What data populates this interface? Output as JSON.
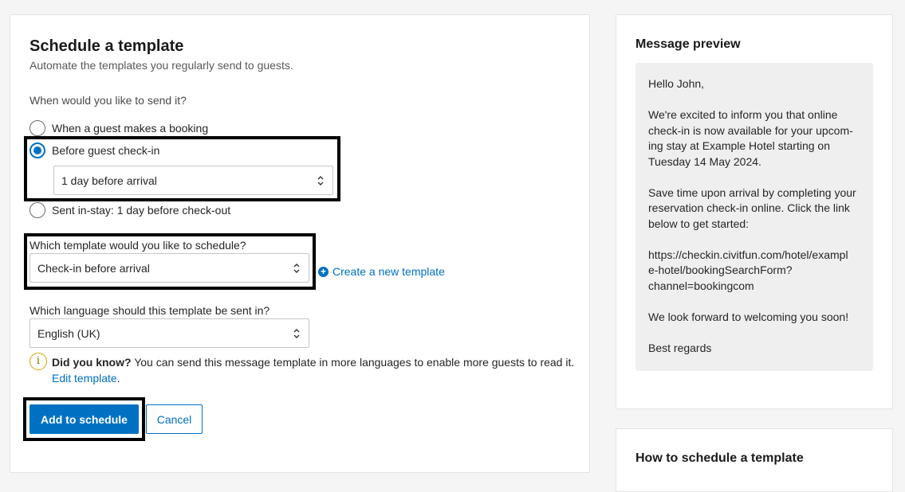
{
  "form": {
    "title": "Schedule a template",
    "subtitle": "Automate the templates you regularly send to guests.",
    "when_question": "When would you like to send it?",
    "options": [
      {
        "label": "When a guest makes a booking",
        "checked": false
      },
      {
        "label": "Before guest check-in",
        "checked": true
      },
      {
        "label": "Sent in-stay: 1 day before check-out",
        "checked": false
      }
    ],
    "timing_select": "1 day before arrival",
    "template_question": "Which template would you like to schedule?",
    "template_select": "Check-in before arrival",
    "create_link": "Create a new template",
    "language_question": "Which language should this template be sent in?",
    "language_select": "English (UK)",
    "tip_bold": "Did you know?",
    "tip_text": " You can send this message template in more languages to enable more guests to read it. ",
    "tip_link": "Edit template",
    "tip_end": ".",
    "add_button": "Add to schedule",
    "cancel_button": "Cancel"
  },
  "preview": {
    "title": "Message preview",
    "greeting": "Hello John,",
    "para1_l1": "We're excited to inform you that online",
    "para1_l2": "check-in is now available for your upcom-",
    "para1_l3": "ing stay at Example Hotel starting on",
    "para1_l4": "Tuesday 14 May 2024.",
    "para2_l1": "Save time upon arrival by completing your",
    "para2_l2": "reservation check-in online. Click the link",
    "para2_l3": "below to get started:",
    "url_l1": "https://checkin.civitfun.com/hotel/exampl",
    "url_l2": "e-hotel/bookingSearchForm?",
    "url_l3": "channel=bookingcom",
    "closing": "We look forward to welcoming you soon!",
    "signoff": "Best regards"
  },
  "howto": {
    "title": "How to schedule a template"
  }
}
